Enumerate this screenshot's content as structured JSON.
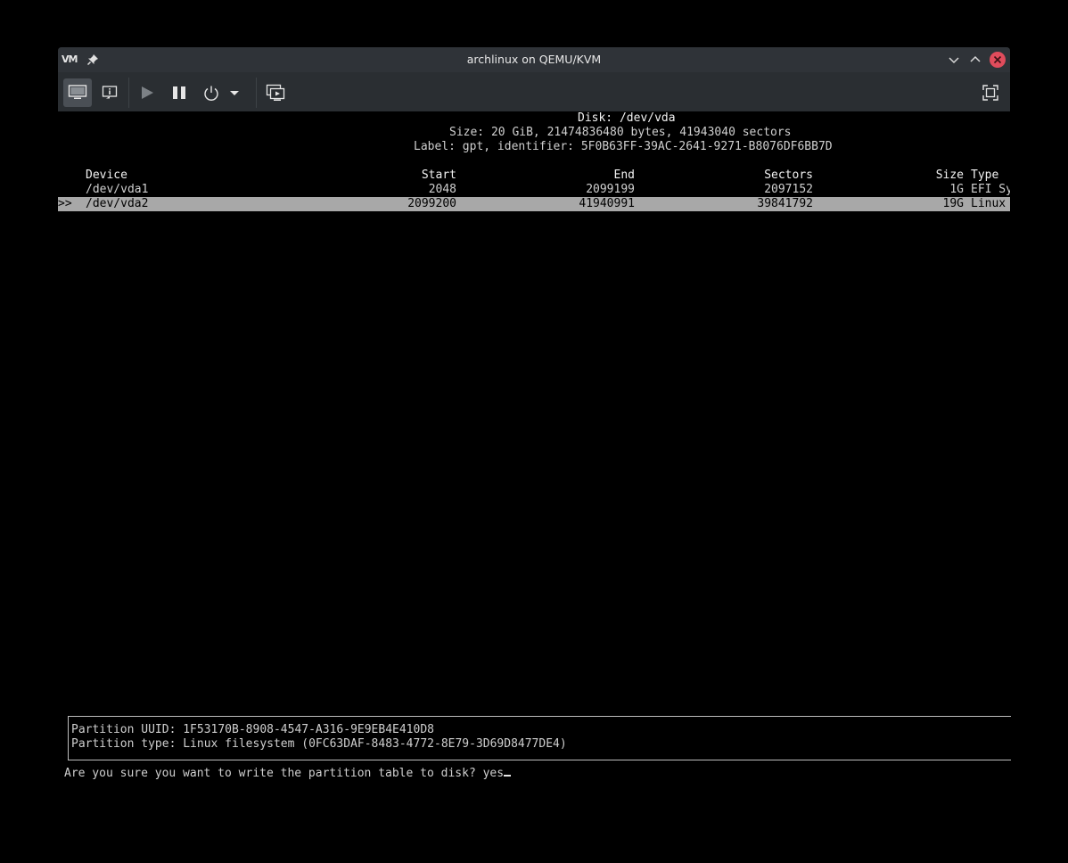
{
  "window": {
    "logo": "VM",
    "title": "archlinux on QEMU/KVM"
  },
  "toolbar": {
    "icons": [
      "monitor-icon",
      "info-icon",
      "play-icon",
      "pause-icon",
      "power-icon",
      "dropdown-arrow-icon",
      "screenshot-icon",
      "fullscreen-icon"
    ]
  },
  "disk": {
    "title": "Disk: /dev/vda",
    "size_line": "Size: 20 GiB, 21474836480 bytes, 41943040 sectors",
    "label_line": "Label: gpt, identifier: 5F0B63FF-39AC-2641-9271-B8076DF6BB7D"
  },
  "table": {
    "headers": {
      "device": "Device",
      "start": "Start",
      "end": "End",
      "sectors": "Sectors",
      "size": "Size",
      "type": "Type"
    },
    "rows": [
      {
        "marker": "",
        "device": "/dev/vda1",
        "start": "2048",
        "end": "2099199",
        "sectors": "2097152",
        "size": "1G",
        "type": "EFI Sy"
      },
      {
        "marker": ">>",
        "device": "/dev/vda2",
        "start": "2099200",
        "end": "41940991",
        "sectors": "39841792",
        "size": "19G",
        "type": "Linux"
      }
    ]
  },
  "info": {
    "uuid_line": "Partition UUID: 1F53170B-8908-4547-A316-9E9EB4E410D8",
    "type_line": "Partition type: Linux filesystem (0FC63DAF-8483-4772-8E79-3D69D8477DE4)"
  },
  "prompt": {
    "text": "Are you sure you want to write the partition table to disk? yes"
  },
  "colors": {
    "selected_row_bg": "#a8a8a8",
    "close_button": "#e04c5c"
  }
}
